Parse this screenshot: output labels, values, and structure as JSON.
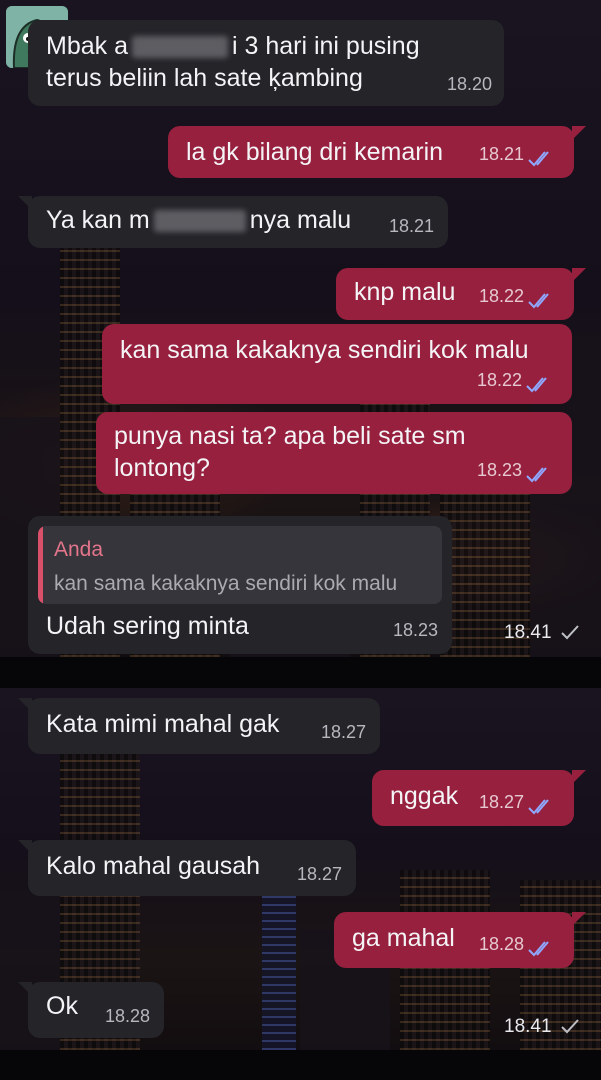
{
  "screenshot_top": {
    "messages": [
      {
        "dir": "in",
        "text_lines": [
          "Mbak a",
          "i 3 hari ini pusing",
          "terus beliin lah sate ķambing"
        ],
        "time": "18.20"
      },
      {
        "dir": "out",
        "text": "la gk bilang dri kemarin",
        "time": "18.21",
        "status": "read"
      },
      {
        "dir": "in",
        "text_parts": [
          "Ya kan m",
          "nya malu"
        ],
        "time": "18.21"
      },
      {
        "dir": "out",
        "text": "knp malu",
        "time": "18.22",
        "status": "read"
      },
      {
        "dir": "out",
        "text": "kan sama kakaknya sendiri kok malu",
        "time": "18.22",
        "status": "read"
      },
      {
        "dir": "out",
        "text_lines": [
          "punya nasi ta? apa beli sate sm",
          "lontong?"
        ],
        "time": "18.23",
        "status": "read"
      },
      {
        "dir": "in",
        "quote": {
          "author": "Anda",
          "text": "kan sama kakaknya sendiri kok malu"
        },
        "text": "Udah sering minta",
        "time": "18.23"
      }
    ],
    "overlay_time": "18.41"
  },
  "screenshot_bottom": {
    "messages": [
      {
        "dir": "in",
        "text": "Kata mimi mahal gak",
        "time": "18.27"
      },
      {
        "dir": "out",
        "text": "nggak",
        "time": "18.27",
        "status": "read"
      },
      {
        "dir": "in",
        "text": "Kalo mahal gausah",
        "time": "18.27"
      },
      {
        "dir": "out",
        "text": "ga mahal",
        "time": "18.28",
        "status": "read"
      },
      {
        "dir": "in",
        "text": "Ok",
        "time": "18.28"
      }
    ],
    "overlay_time": "18.41"
  },
  "colors": {
    "incoming": "#242429",
    "outgoing": "#97203f",
    "read_ticks": "#8fa8ff",
    "quote_accent": "#d8506a"
  },
  "icons": {
    "read": "double-check-icon",
    "sent": "single-check-icon",
    "avatar": "sticker-avatar"
  }
}
